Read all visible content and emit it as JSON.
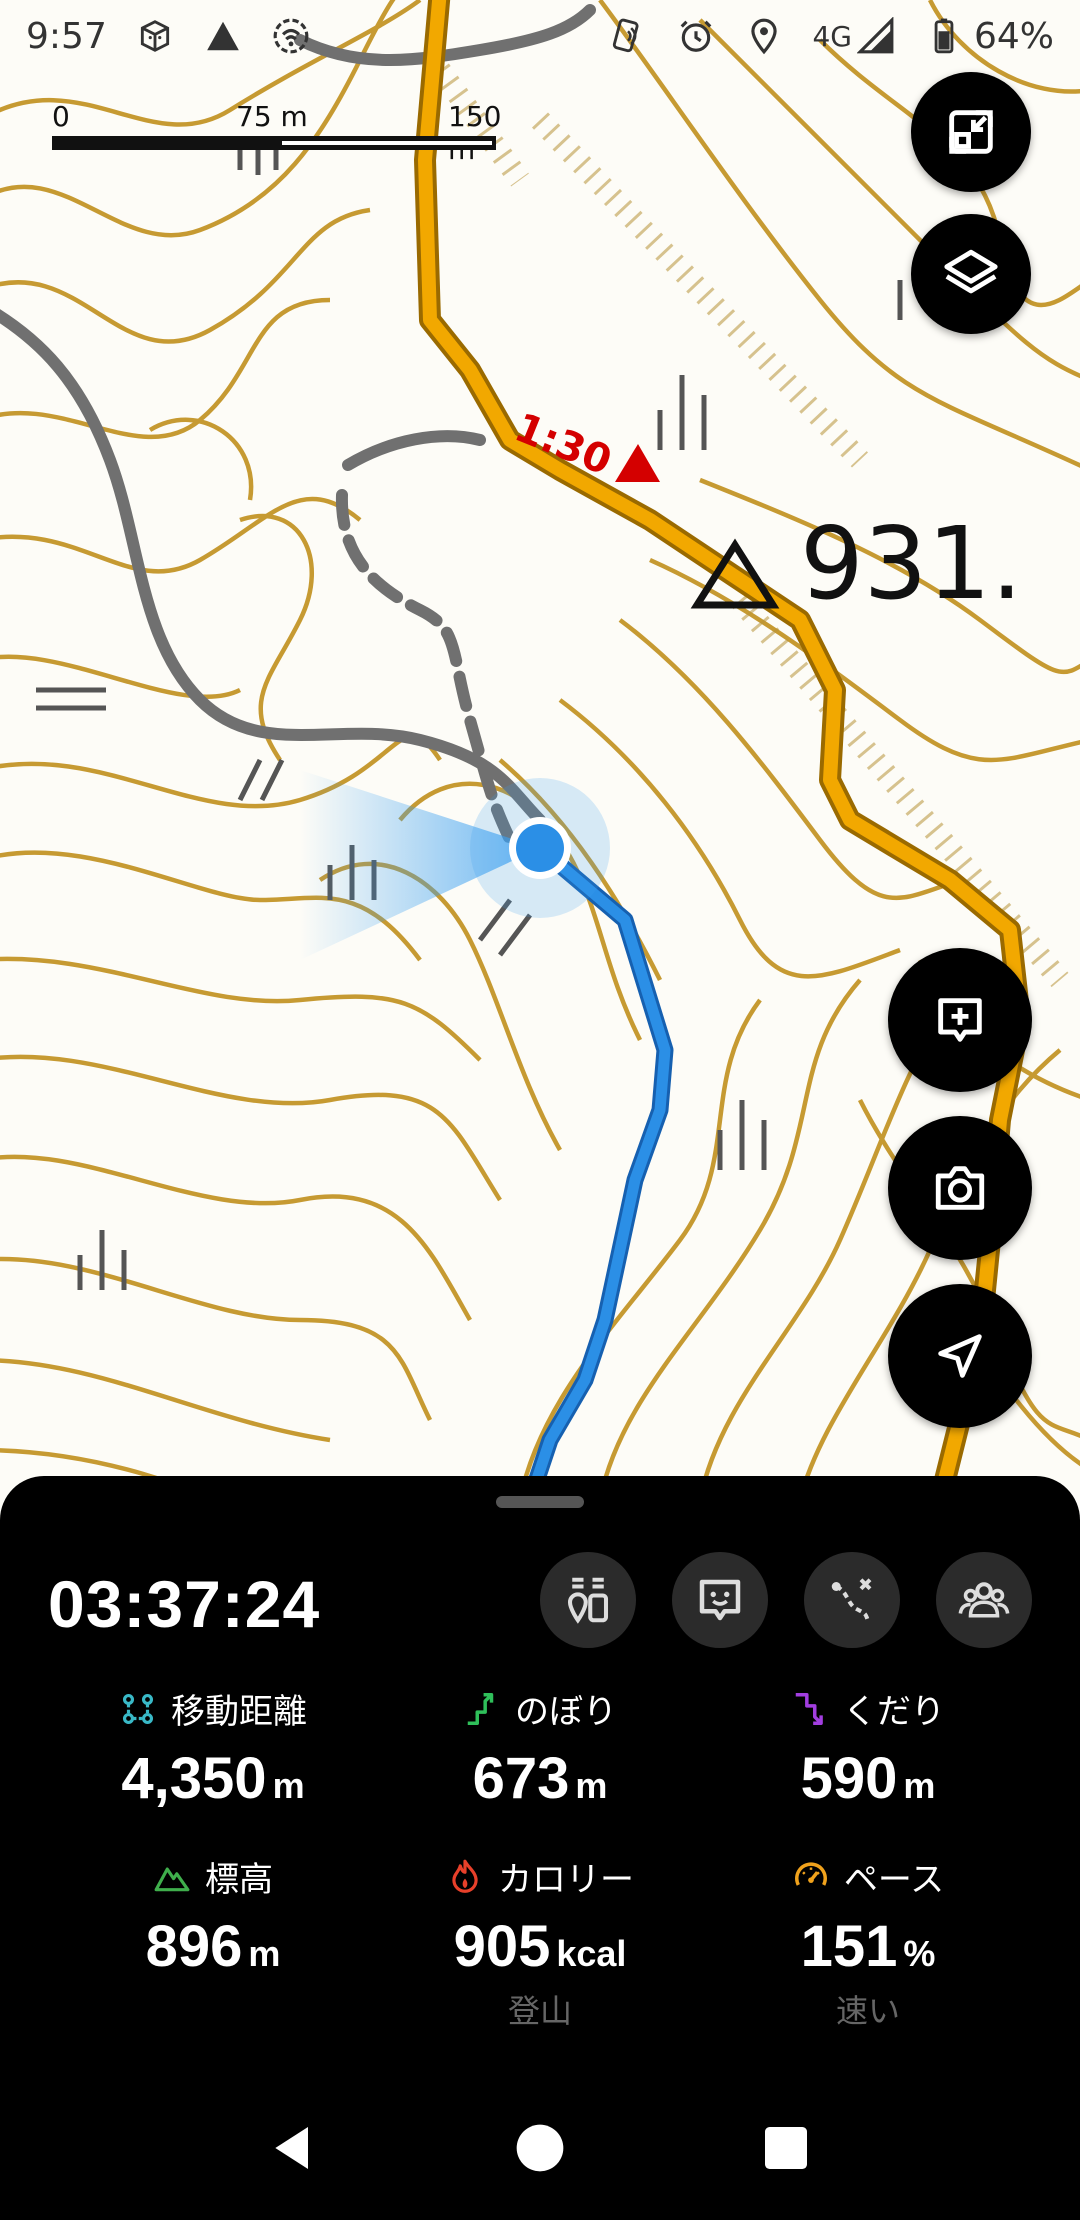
{
  "status_bar": {
    "time": "9:57",
    "network": "4G",
    "battery": "64%",
    "icons": [
      "sim-toolkit-icon",
      "alert-icon",
      "hotspot-icon",
      "nfc-icon",
      "alarm-icon",
      "location-icon",
      "signal-icon",
      "battery-icon"
    ]
  },
  "map": {
    "scale": {
      "zero": "0",
      "mid": "75 m",
      "max": "150 m"
    },
    "time_label": "1:30",
    "elevation_label": "931.",
    "colors": {
      "contour": "#c69a32",
      "trail": "#f2a800",
      "track": "#2b8fe6",
      "road": "#707070",
      "marker": "#d40000"
    }
  },
  "fabs": [
    "fit-bounds-icon",
    "layers-icon",
    "add-note-icon",
    "camera-icon",
    "navigation-icon"
  ],
  "sheet": {
    "timer": "03:37:24",
    "action_icons": [
      "checkpoint-list-icon",
      "memo-icon",
      "route-icon",
      "group-icon"
    ],
    "stats": [
      {
        "label": "移動距離",
        "value": "4,350",
        "unit": "m",
        "sub": "",
        "icon": "distance-icon",
        "icon_color": "#39b9c7"
      },
      {
        "label": "のぼり",
        "value": "673",
        "unit": "m",
        "sub": "",
        "icon": "ascent-icon",
        "icon_color": "#2fbf5a"
      },
      {
        "label": "くだり",
        "value": "590",
        "unit": "m",
        "sub": "",
        "icon": "descent-icon",
        "icon_color": "#a23ee0"
      },
      {
        "label": "標高",
        "value": "896",
        "unit": "m",
        "sub": "",
        "icon": "mountain-icon",
        "icon_color": "#3fae4c"
      },
      {
        "label": "カロリー",
        "value": "905",
        "unit": "kcal",
        "sub": "登山",
        "icon": "flame-icon",
        "icon_color": "#e8402a"
      },
      {
        "label": "ペース",
        "value": "151",
        "unit": "%",
        "sub": "速い",
        "icon": "speedometer-icon",
        "icon_color": "#f0a21c"
      }
    ]
  },
  "nav": {
    "icons": [
      "back-icon",
      "home-icon",
      "recents-icon"
    ]
  }
}
